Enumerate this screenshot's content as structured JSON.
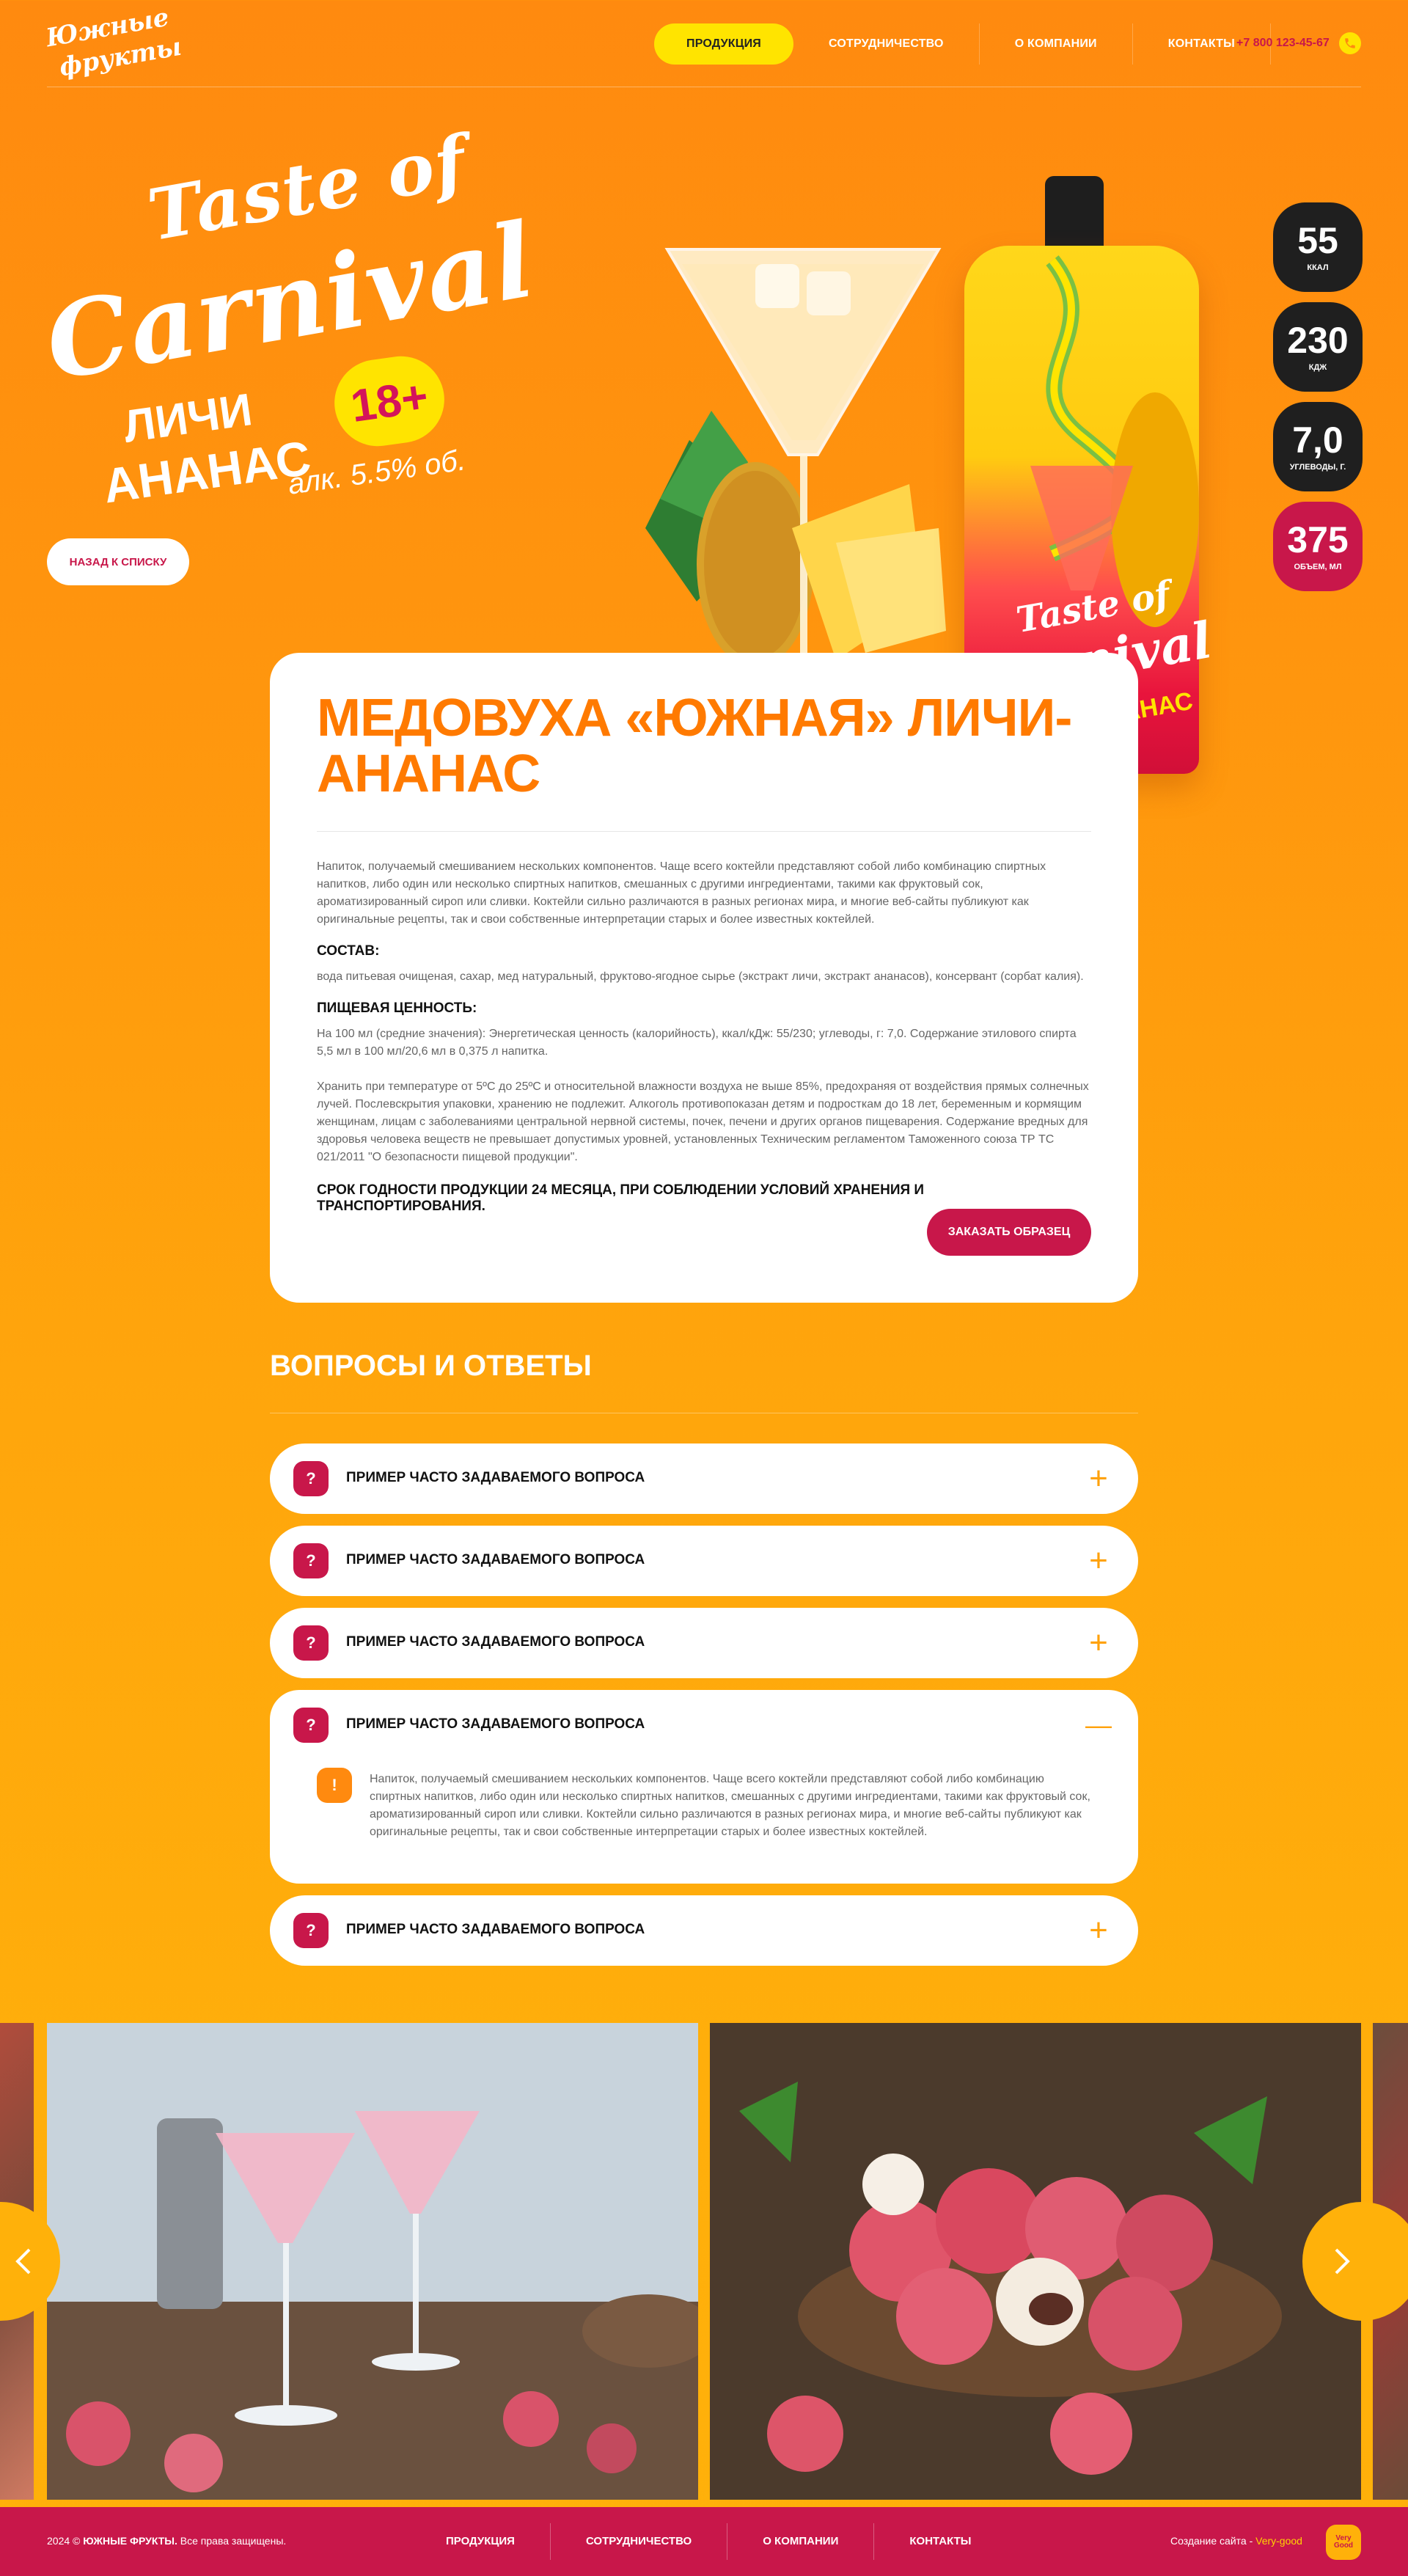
{
  "header": {
    "logo_line1": "Южные",
    "logo_line2": "фрукты",
    "nav": [
      "ПРОДУКЦИЯ",
      "СОТРУДНИЧЕСТВО",
      "О КОМПАНИИ",
      "КОНТАКТЫ"
    ],
    "phone": "+7 800 123-45-67",
    "phone_icon": "whatsapp-icon",
    "colors": {
      "accent": "#ffe400",
      "brand": "#c8174a",
      "orange": "#ff7a00"
    }
  },
  "hero": {
    "taste": "Taste of",
    "carnival": "Carnival",
    "flavor_line1": "ЛИЧИ",
    "flavor_line2": "АНАНАС",
    "age": "18+",
    "alcohol": "алк. 5.5% об.",
    "back_button": "НАЗАД К СПИСКУ"
  },
  "pouch": {
    "line1": "Taste of",
    "line2": "Carnival",
    "line3": "ЛИЧИ · АНАНАС"
  },
  "badges": [
    {
      "num": "55",
      "label": "ККАЛ"
    },
    {
      "num": "230",
      "label": "КДЖ"
    },
    {
      "num": "7,0",
      "label": "УГЛЕВОДЫ, Г."
    },
    {
      "num": "375",
      "label": "ОБЪЕМ, МЛ"
    }
  ],
  "product": {
    "title": "МЕДОВУХА «ЮЖНАЯ» ЛИЧИ-АНАНАС",
    "intro": "Напиток, получаемый смешиванием нескольких компонентов. Чаще всего коктейли представляют собой либо комбинацию спиртных напитков, либо один или несколько спиртных напитков, смешанных с другими ингредиентами, такими как фруктовый сок, ароматизированный сироп или сливки. Коктейли сильно различаются в разных регионах мира, и многие веб-сайты публикуют как оригинальные рецепты, так и свои собственные интерпретации старых и более известных коктейлей.",
    "composition_title": "СОСТАВ:",
    "composition": "вода питьевая очищеная, сахар, мед натуральный, фруктово-ягодное сырье (экстракт личи, экстракт ананасов), консервант (сорбат калия).",
    "nutrition_title": "ПИЩЕВАЯ ЦЕННОСТЬ:",
    "nutrition": "На 100 мл (средние значения): Энергетическая ценность (калорийность), ккал/кДж: 55/230; углеводы, г: 7,0. Содержание этилового спирта 5,5 мл в 100 мл/20,6 мл в 0,375 л напитка.",
    "storage": "Хранить при температуре от 5ºС до 25ºС и относительной влажности воздуха не выше 85%, предохраняя от воздействия прямых солнечных лучей. Послевскрытия упаковки, хранению не подлежит. Алкоголь противопоказан детям и подросткам до 18 лет, беременным и кормящим женщинам, лицам с заболеваниями центральной нервной системы, почек, печени и других органов пищеварения. Содержание вредных для здоровья человека веществ не превышает допустимых уровней, установленных Техническим регламентом Таможенного союза ТР ТС 021/2011 \"О безопасности пищевой продукции\".",
    "shelf_life": "СРОК ГОДНОСТИ ПРОДУКЦИИ 24 МЕСЯЦА, ПРИ СОБЛЮДЕНИИ УСЛОВИЙ ХРАНЕНИЯ И ТРАНСПОРТИРОВАНИЯ.",
    "order_button": "ЗАКАЗАТЬ ОБРАЗЕЦ"
  },
  "faq": {
    "title": "ВОПРОСЫ И ОТВЕТЫ",
    "q_mark": "?",
    "a_mark": "!",
    "plus": "+",
    "minus": "—",
    "items": [
      {
        "q": "ПРИМЕР ЧАСТО ЗАДАВАЕМОГО ВОПРОСА"
      },
      {
        "q": "ПРИМЕР ЧАСТО ЗАДАВАЕМОГО ВОПРОСА"
      },
      {
        "q": "ПРИМЕР ЧАСТО ЗАДАВАЕМОГО ВОПРОСА"
      },
      {
        "q": "ПРИМЕР ЧАСТО ЗАДАВАЕМОГО ВОПРОСА",
        "a": "Напиток, получаемый смешиванием нескольких компонентов. Чаще всего коктейли представляют собой либо комбинацию спиртных напитков, либо один или несколько спиртных напитков, смешанных с другими ингредиентами, такими как фруктовый сок, ароматизированный сироп или сливки. Коктейли сильно различаются в разных регионах мира, и многие веб-сайты публикуют как оригинальные рецепты, так и свои собственные интерпретации старых и более известных коктейлей."
      },
      {
        "q": "ПРИМЕР ЧАСТО ЗАДАВАЕМОГО ВОПРОСА"
      }
    ]
  },
  "gallery": {
    "prev_icon": "chevron-left-icon",
    "next_icon": "chevron-right-icon"
  },
  "footer": {
    "copy_prefix": "2024 © ",
    "copy_brand": "ЮЖНЫЕ ФРУКТЫ.",
    "copy_suffix": " Все права защищены.",
    "nav": [
      "ПРОДУКЦИЯ",
      "СОТРУДНИЧЕСТВО",
      "О КОМПАНИИ",
      "КОНТАКТЫ"
    ],
    "dev_label": "Создание сайта - ",
    "dev_name": "Very-good",
    "dev_logo": "Very Good"
  }
}
